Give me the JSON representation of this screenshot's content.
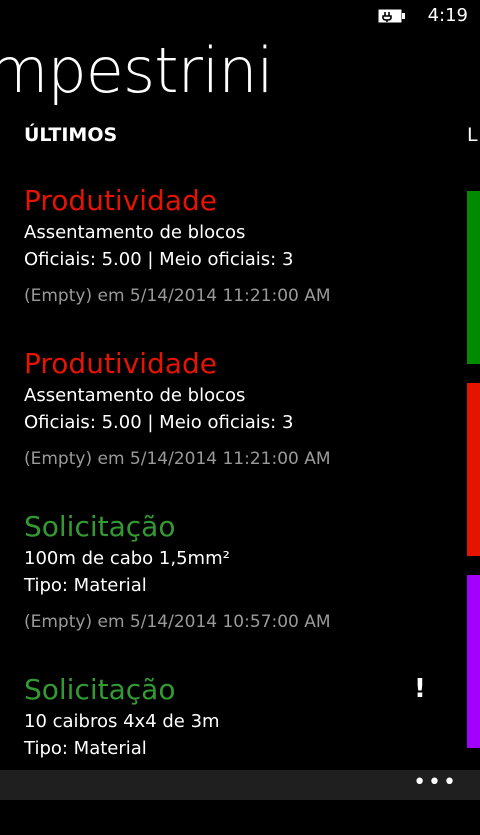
{
  "status": {
    "time": "4:19"
  },
  "panorama": {
    "title": "mpestrini"
  },
  "section": {
    "header": "ÚLTIMOS",
    "next_header_peek": "L"
  },
  "colors": {
    "produtividade": "#e51400",
    "solicitacao": "#339933",
    "tile_green": "#008a00",
    "tile_red": "#e51400",
    "tile_purple": "#a200ff"
  },
  "items": [
    {
      "title": "Produtividade",
      "type": "produtividade",
      "line1": "Assentamento de blocos",
      "line2": "Oficiais: 5.00 | Meio oficiais: 3",
      "meta": "(Empty) em 5/14/2014 11:21:00 AM"
    },
    {
      "title": "Produtividade",
      "type": "produtividade",
      "line1": "Assentamento de blocos",
      "line2": "Oficiais: 5.00 | Meio oficiais: 3",
      "meta": "(Empty) em 5/14/2014 11:21:00 AM"
    },
    {
      "title": "Solicitação",
      "type": "solicitacao",
      "line1": "100m de cabo 1,5mm²",
      "line2": "Tipo: Material",
      "meta": "(Empty) em 5/14/2014 10:57:00 AM"
    },
    {
      "title": "Solicitação",
      "type": "solicitacao",
      "line1": "10 caibros 4x4 de 3m",
      "line2": "Tipo: Material",
      "flag": "!"
    }
  ],
  "app_bar": {
    "more_label": "•••"
  }
}
